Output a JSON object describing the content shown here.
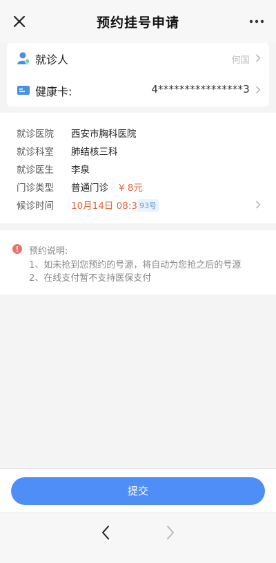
{
  "header": {
    "title": "预约挂号申请",
    "close_icon": "close-icon",
    "more_icon": "more-icon"
  },
  "patient_card": {
    "patient": {
      "label": "就诊人",
      "value": "何国",
      "icon": "user-icon"
    },
    "health_card": {
      "label": "健康卡:",
      "value": "4****************3",
      "icon": "card-icon"
    }
  },
  "appointment": {
    "hospital": {
      "label": "就诊医院",
      "value": "西安市胸科医院"
    },
    "department": {
      "label": "就诊科室",
      "value": "肺结核三科"
    },
    "doctor": {
      "label": "就诊医生",
      "value": "李泉"
    },
    "clinic_type": {
      "label": "门诊类型",
      "value": "普通门诊",
      "price": "¥ 8元"
    },
    "wait_time": {
      "label": "候诊时间",
      "value": "10月14日 08:31",
      "number": "93号"
    }
  },
  "notes": {
    "title": "预约说明:",
    "lines": [
      "1、如未抢到您预约的号源，将自动为您抢之后的号源",
      "2、在线支付暂不支持医保支付"
    ],
    "icon": "info-icon"
  },
  "footer": {
    "submit_label": "提交"
  },
  "colors": {
    "primary": "#4f8ef7",
    "price": "#e0643a",
    "badge": "#5a9be8",
    "icon_blue": "#4a90e2",
    "info_red": "#e8736a"
  }
}
